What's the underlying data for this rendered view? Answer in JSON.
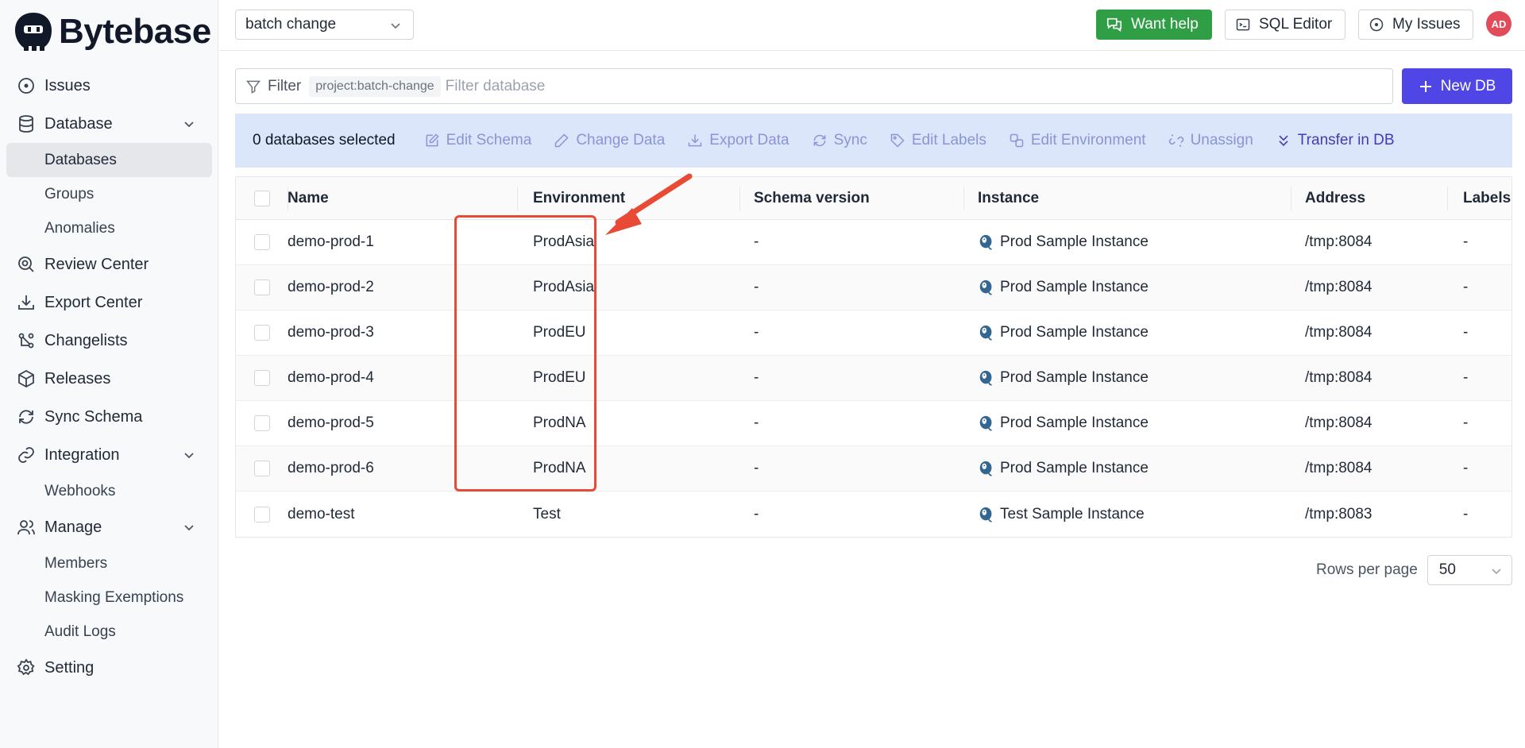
{
  "app": {
    "name": "Bytebase"
  },
  "sidebar": {
    "items": [
      {
        "label": "Issues",
        "icon": "circle-dot-icon",
        "expandable": false
      },
      {
        "label": "Database",
        "icon": "database-icon",
        "expandable": true,
        "children": [
          {
            "label": "Databases",
            "active": true
          },
          {
            "label": "Groups"
          },
          {
            "label": "Anomalies"
          }
        ]
      },
      {
        "label": "Review Center",
        "icon": "search-review-icon",
        "expandable": false
      },
      {
        "label": "Export Center",
        "icon": "download-icon",
        "expandable": false
      },
      {
        "label": "Changelists",
        "icon": "changelist-icon",
        "expandable": false
      },
      {
        "label": "Releases",
        "icon": "package-icon",
        "expandable": false
      },
      {
        "label": "Sync Schema",
        "icon": "sync-icon",
        "expandable": false
      },
      {
        "label": "Integration",
        "icon": "link-icon",
        "expandable": true,
        "children": [
          {
            "label": "Webhooks"
          }
        ]
      },
      {
        "label": "Manage",
        "icon": "users-icon",
        "expandable": true,
        "children": [
          {
            "label": "Members"
          },
          {
            "label": "Masking Exemptions"
          },
          {
            "label": "Audit Logs"
          }
        ]
      },
      {
        "label": "Setting",
        "icon": "gear-icon",
        "expandable": false
      }
    ]
  },
  "header": {
    "project_select": "batch change",
    "want_help": "Want help",
    "sql_editor": "SQL Editor",
    "my_issues": "My Issues",
    "avatar_initials": "AD",
    "avatar_color": "#e14b5a",
    "help_color": "#2f9e44"
  },
  "filter": {
    "label": "Filter",
    "tag": "project:batch-change",
    "placeholder": "Filter database"
  },
  "new_db": {
    "label": "New DB",
    "color": "#4f46e5"
  },
  "actions": {
    "selected_count": "0 databases selected",
    "edit_schema": "Edit Schema",
    "change_data": "Change Data",
    "export_data": "Export Data",
    "sync": "Sync",
    "edit_labels": "Edit Labels",
    "edit_environment": "Edit Environment",
    "unassign": "Unassign",
    "transfer_in_db": "Transfer in DB"
  },
  "table": {
    "columns": [
      "Name",
      "Environment",
      "Schema version",
      "Instance",
      "Address",
      "Labels"
    ],
    "rows": [
      {
        "name": "demo-prod-1",
        "environment": "ProdAsia",
        "schema_version": "-",
        "instance": "Prod Sample Instance",
        "address": "/tmp:8084",
        "labels": "-"
      },
      {
        "name": "demo-prod-2",
        "environment": "ProdAsia",
        "schema_version": "-",
        "instance": "Prod Sample Instance",
        "address": "/tmp:8084",
        "labels": "-"
      },
      {
        "name": "demo-prod-3",
        "environment": "ProdEU",
        "schema_version": "-",
        "instance": "Prod Sample Instance",
        "address": "/tmp:8084",
        "labels": "-"
      },
      {
        "name": "demo-prod-4",
        "environment": "ProdEU",
        "schema_version": "-",
        "instance": "Prod Sample Instance",
        "address": "/tmp:8084",
        "labels": "-"
      },
      {
        "name": "demo-prod-5",
        "environment": "ProdNA",
        "schema_version": "-",
        "instance": "Prod Sample Instance",
        "address": "/tmp:8084",
        "labels": "-"
      },
      {
        "name": "demo-prod-6",
        "environment": "ProdNA",
        "schema_version": "-",
        "instance": "Prod Sample Instance",
        "address": "/tmp:8084",
        "labels": "-"
      },
      {
        "name": "demo-test",
        "environment": "Test",
        "schema_version": "-",
        "instance": "Test Sample Instance",
        "address": "/tmp:8083",
        "labels": "-"
      }
    ]
  },
  "pagination": {
    "label": "Rows per page",
    "value": "50"
  },
  "annotation": {
    "color": "#e84a36"
  }
}
